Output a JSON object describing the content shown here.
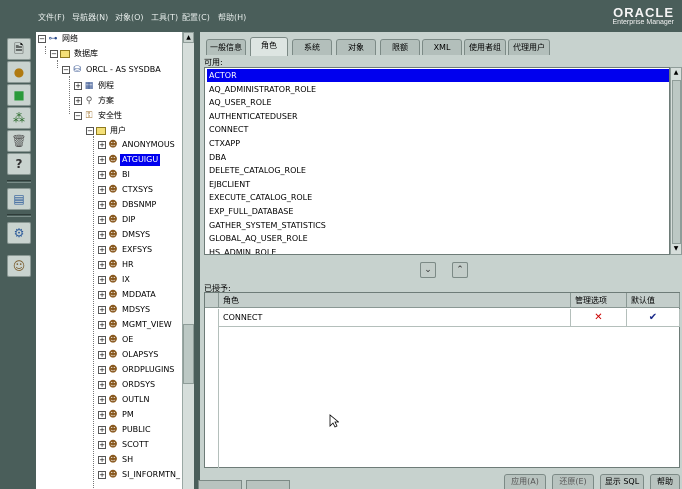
{
  "menu": [
    "文件(F)",
    "导航器(N)",
    "对象(O)",
    "工具(T)",
    "配置(C)",
    "帮助(H)"
  ],
  "brand": {
    "name": "ORACLE",
    "product": "Enterprise Manager"
  },
  "toolbar_icons": [
    "document-icon",
    "key-icon",
    "cube-icon",
    "tree-nodes-icon",
    "trash-icon",
    "help-icon",
    "edit-table-icon",
    "tools-icon",
    "users-icon"
  ],
  "tree": {
    "network": "网络",
    "databases": "数据库",
    "db": "ORCL - AS SYSDBA",
    "instance": "例程",
    "schema": "方案",
    "security": "安全性",
    "users": "用户",
    "user_list": [
      "ANONYMOUS",
      "ATGUIGU",
      "BI",
      "CTXSYS",
      "DBSNMP",
      "DIP",
      "DMSYS",
      "EXFSYS",
      "HR",
      "IX",
      "MDDATA",
      "MDSYS",
      "MGMT_VIEW",
      "OE",
      "OLAPSYS",
      "ORDPLUGINS",
      "ORDSYS",
      "OUTLN",
      "PM",
      "PUBLIC",
      "SCOTT",
      "SH",
      "SI_INFORMTN_"
    ],
    "selected_user": "ATGUIGU"
  },
  "tabs": [
    "一般信息",
    "角色",
    "系统",
    "对象",
    "限额",
    "XML",
    "使用者组",
    "代理用户"
  ],
  "active_tab": "角色",
  "available_label": "可用:",
  "available_roles": [
    "ACTOR",
    "AQ_ADMINISTRATOR_ROLE",
    "AQ_USER_ROLE",
    "AUTHENTICATEDUSER",
    "CONNECT",
    "CTXAPP",
    "DBA",
    "DELETE_CATALOG_ROLE",
    "EJBCLIENT",
    "EXECUTE_CATALOG_ROLE",
    "EXP_FULL_DATABASE",
    "GATHER_SYSTEM_STATISTICS",
    "GLOBAL_AQ_USER_ROLE",
    "HS_ADMIN_ROLE"
  ],
  "selected_role": "ACTOR",
  "granted_label": "已授予:",
  "granted_columns": [
    "角色",
    "管理选项",
    "默认值"
  ],
  "granted_rows": [
    {
      "role": "CONNECT",
      "admin_option": "✕",
      "default": "✔"
    }
  ],
  "bottom_buttons": [
    "应用(A)",
    "还原(E)",
    "显示 SQL",
    "帮助"
  ],
  "colors": {
    "selection": "#0000ee",
    "admin_x": "#cc0000",
    "default_check": "#1a2a8a"
  }
}
